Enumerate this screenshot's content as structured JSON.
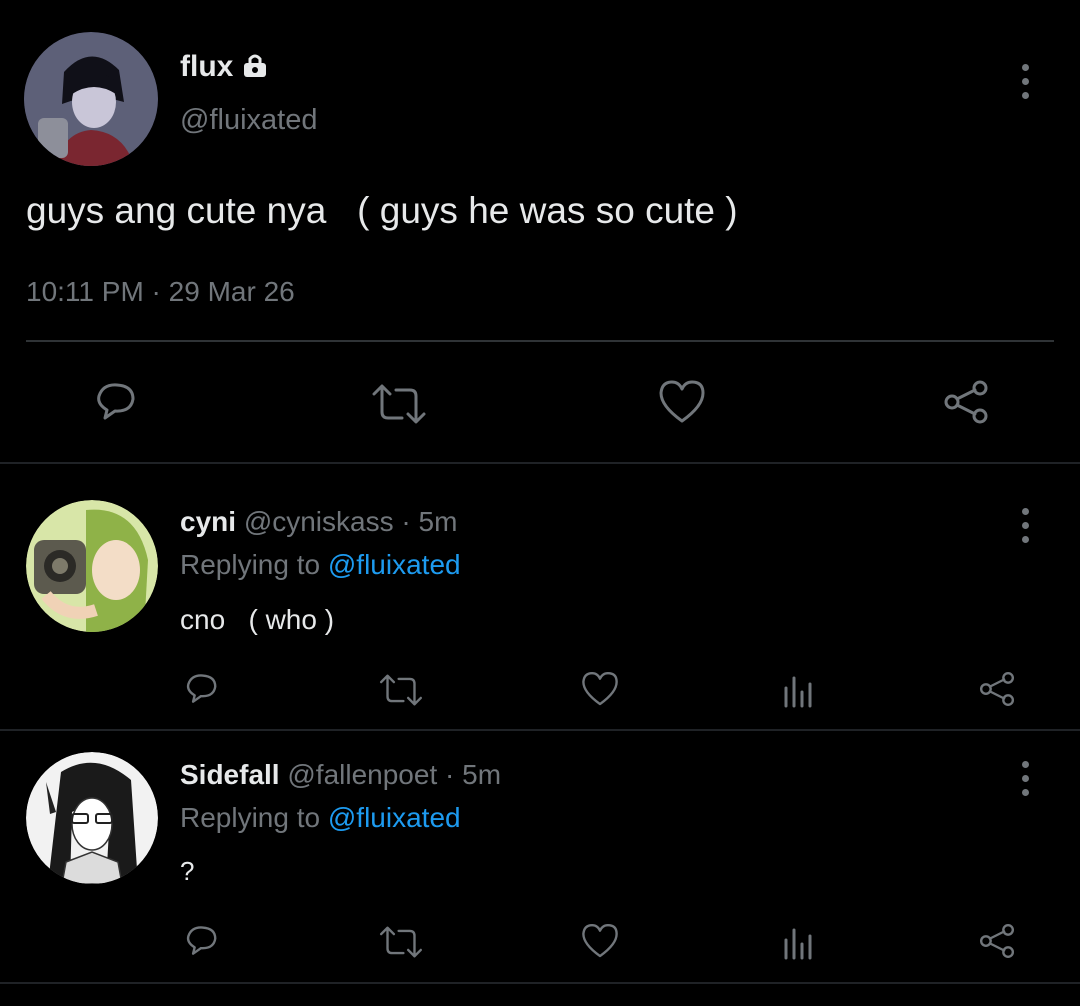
{
  "main_tweet": {
    "display_name": "flux",
    "handle": "@fluixated",
    "text": "guys ang cute nya   ( guys he was so cute )",
    "timestamp": "10:11 PM · 29 Mar 26",
    "locked_icon": "lock-icon"
  },
  "replies": [
    {
      "display_name": "cyni",
      "handle": "@cyniskass",
      "time": "5m",
      "replying_prefix": "Replying to",
      "replying_to": "@fluixated",
      "text": "cno   ( who )"
    },
    {
      "display_name": "Sidefall",
      "handle": "@fallenpoet",
      "time": "5m",
      "replying_prefix": "Replying to",
      "replying_to": "@fluixated",
      "text": "?"
    }
  ],
  "icons": {
    "reply": "reply-icon",
    "retweet": "retweet-icon",
    "like": "heart-icon",
    "analytics": "analytics-icon",
    "share": "share-icon",
    "more": "more-options-icon"
  },
  "colors": {
    "background": "#000000",
    "text": "#e7e9ea",
    "muted": "#71767b",
    "link": "#1d9bf0"
  }
}
